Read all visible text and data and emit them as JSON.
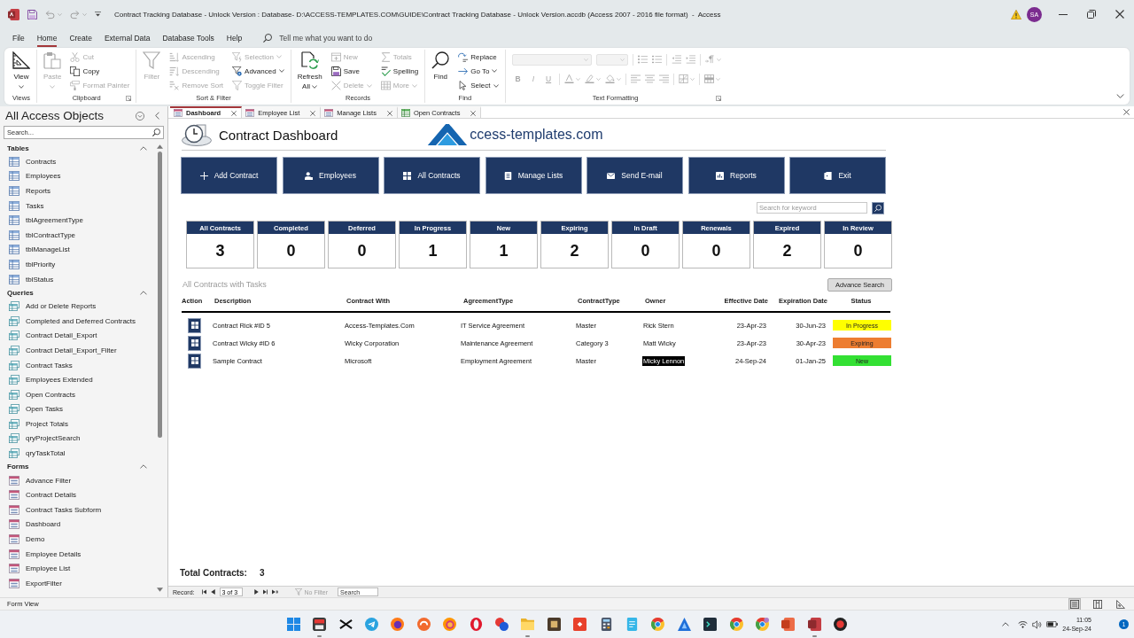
{
  "window": {
    "title": "Contract Tracking Database - Unlock Version : Database- D:\\ACCESS-TEMPLATES.COM\\GUIDE\\Contract Tracking Database - Unlock Version.accdb (Access 2007 - 2016 file format)  -  Access",
    "account_initials": "SA"
  },
  "menu_tabs": [
    {
      "label": "File",
      "selected": false
    },
    {
      "label": "Home",
      "selected": true
    },
    {
      "label": "Create",
      "selected": false
    },
    {
      "label": "External Data",
      "selected": false
    },
    {
      "label": "Database Tools",
      "selected": false
    },
    {
      "label": "Help",
      "selected": false
    }
  ],
  "tell_me": {
    "placeholder": "Tell me what you want to do"
  },
  "ribbon": {
    "groups": [
      {
        "label": "Views",
        "launcher": false,
        "columns": [
          {
            "kind": "large",
            "items": [
              {
                "label": "View",
                "disabled": false,
                "dropdown": true
              }
            ]
          }
        ]
      },
      {
        "label": "Clipboard",
        "launcher": true,
        "columns": [
          {
            "kind": "large",
            "items": [
              {
                "label": "Paste",
                "disabled": true,
                "dropdown": true
              }
            ]
          },
          {
            "kind": "small",
            "items": [
              {
                "label": "Cut",
                "disabled": true,
                "dropdown": false
              },
              {
                "label": "Copy",
                "disabled": false,
                "dropdown": false
              },
              {
                "label": "Format Painter",
                "disabled": true,
                "dropdown": false
              }
            ]
          }
        ]
      },
      {
        "label": "Sort & Filter",
        "launcher": false,
        "columns": [
          {
            "kind": "large",
            "items": [
              {
                "label": "Filter",
                "disabled": true,
                "dropdown": false
              }
            ]
          },
          {
            "kind": "small",
            "items": [
              {
                "label": "Ascending",
                "disabled": true,
                "dropdown": false
              },
              {
                "label": "Descending",
                "disabled": true,
                "dropdown": false
              },
              {
                "label": "Remove Sort",
                "disabled": true,
                "dropdown": false
              }
            ]
          },
          {
            "kind": "small",
            "items": [
              {
                "label": "Selection",
                "disabled": true,
                "dropdown": true
              },
              {
                "label": "Advanced",
                "disabled": false,
                "dropdown": true
              },
              {
                "label": "Toggle Filter",
                "disabled": true,
                "dropdown": false
              }
            ]
          }
        ]
      },
      {
        "label": "Records",
        "launcher": false,
        "columns": [
          {
            "kind": "large",
            "items": [
              {
                "label": "Refresh All",
                "disabled": false,
                "dropdown": true
              }
            ]
          },
          {
            "kind": "small",
            "items": [
              {
                "label": "New",
                "disabled": true,
                "dropdown": false
              },
              {
                "label": "Save",
                "disabled": false,
                "dropdown": false
              },
              {
                "label": "Delete",
                "disabled": true,
                "dropdown": true
              }
            ]
          },
          {
            "kind": "small",
            "items": [
              {
                "label": "Totals",
                "disabled": true,
                "dropdown": false
              },
              {
                "label": "Spelling",
                "disabled": false,
                "dropdown": false
              },
              {
                "label": "More",
                "disabled": true,
                "dropdown": true
              }
            ]
          }
        ]
      },
      {
        "label": "Find",
        "launcher": false,
        "columns": [
          {
            "kind": "large",
            "items": [
              {
                "label": "Find",
                "disabled": false,
                "dropdown": false
              }
            ]
          },
          {
            "kind": "small",
            "items": [
              {
                "label": "Replace",
                "disabled": false,
                "dropdown": false
              },
              {
                "label": "Go To",
                "disabled": false,
                "dropdown": true
              },
              {
                "label": "Select",
                "disabled": false,
                "dropdown": true
              }
            ]
          }
        ]
      }
    ],
    "text_formatting": {
      "label": "Text Formatting",
      "launcher": true,
      "disabled": true,
      "letters": [
        "B",
        "I",
        "U"
      ]
    }
  },
  "navigation": {
    "title": "All Access Objects",
    "search": {
      "placeholder": "Search..."
    },
    "groups": [
      {
        "label": "Tables",
        "kind": "table",
        "expanded": true,
        "items": [
          "Contracts",
          "Employees",
          "Reports",
          "Tasks",
          "tblAgreementType",
          "tblContractType",
          "tblManageList",
          "tblPriority",
          "tblStatus"
        ]
      },
      {
        "label": "Queries",
        "kind": "query",
        "expanded": true,
        "items": [
          "Add or Delete Reports",
          "Completed and Deferred Contracts",
          "Contract Detail_Export",
          "Contract Detail_Export_Filter",
          "Contract Tasks",
          "Employees Extended",
          "Open Contracts",
          "Open Tasks",
          "Project Totals",
          "qryProjectSearch",
          "qryTaskTotal"
        ]
      },
      {
        "label": "Forms",
        "kind": "form",
        "expanded": true,
        "items": [
          "Advance Filter",
          "Contract Details",
          "Contract Tasks Subform",
          "Dashboard",
          "Demo",
          "Employee Details",
          "Employee List",
          "ExportFilter"
        ]
      }
    ]
  },
  "document_tabs": [
    {
      "label": "Dashboard",
      "kind": "form",
      "selected": true
    },
    {
      "label": "Employee List",
      "kind": "form",
      "selected": false
    },
    {
      "label": "Manage Lists",
      "kind": "form",
      "selected": false
    },
    {
      "label": "Open Contracts",
      "kind": "datasheet",
      "selected": false
    }
  ],
  "form": {
    "title": "Contract Dashboard",
    "logo_text": "ccess-templates.com",
    "nav_buttons": [
      "Add Contract",
      "Employees",
      "All Contracts",
      "Manage Lists",
      "Send E-mail",
      "Reports",
      "Exit"
    ],
    "search": {
      "placeholder": "Search for keyword"
    },
    "stats": [
      {
        "label": "All Contracts",
        "value": "3"
      },
      {
        "label": "Completed",
        "value": "0"
      },
      {
        "label": "Deferred",
        "value": "0"
      },
      {
        "label": "In Progress",
        "value": "1"
      },
      {
        "label": "New",
        "value": "1"
      },
      {
        "label": "Expiring",
        "value": "2"
      },
      {
        "label": "In Draft",
        "value": "0"
      },
      {
        "label": "Renewals",
        "value": "0"
      },
      {
        "label": "Expired",
        "value": "2"
      },
      {
        "label": "In Review",
        "value": "0"
      }
    ],
    "section_title": "All Contracts with Tasks",
    "advance_search": "Advance Search",
    "table": {
      "columns": [
        "Action",
        "Description",
        "Contract With",
        "AgreementType",
        "ContractType",
        "Owner",
        "Effective Date",
        "Expiration Date",
        "Status"
      ],
      "rows": [
        {
          "description": "Contract Rick #ID 5",
          "contract_with": "Access-Templates.Com",
          "agreement_type": "IT Service Agreement",
          "contract_type": "Master",
          "owner": "Rick Stern",
          "effective_date": "23-Apr-23",
          "expiration_date": "30-Jun-23",
          "status": "In Progress",
          "color": "#ffff00",
          "selected": false
        },
        {
          "description": "Contract Wicky #ID 6",
          "contract_with": "Wicky Corporation",
          "agreement_type": "Maintenance Agreement",
          "contract_type": "Category 3",
          "owner": "Matt Wicky",
          "effective_date": "23-Apr-23",
          "expiration_date": "30-Apr-23",
          "status": "Expiring",
          "color": "#ed7d31",
          "selected": false
        },
        {
          "description": "Sample Contract",
          "contract_with": "Microsoft",
          "agreement_type": "Employment Agreement",
          "contract_type": "Master",
          "owner": "Micky Lennon",
          "effective_date": "24-Sep-24",
          "expiration_date": "01-Jan-25",
          "status": "New",
          "color": "#33e033",
          "selected": true
        }
      ]
    },
    "footer": {
      "label": "Total Contracts:",
      "value": "3"
    }
  },
  "record_nav": {
    "label": "Record:",
    "position": "3 of 3",
    "filter": {
      "label": "No Filter",
      "active": false
    },
    "search": {
      "placeholder": "Search"
    }
  },
  "status_bar": {
    "text": "Form View",
    "views": [
      {
        "selected": true
      },
      {
        "selected": false
      },
      {
        "selected": false
      }
    ]
  },
  "taskbar": {
    "apps": [
      {
        "running": false
      },
      {
        "running": true
      },
      {
        "running": false
      },
      {
        "running": false
      },
      {
        "running": false
      },
      {
        "running": false
      },
      {
        "running": false
      },
      {
        "running": false
      },
      {
        "running": false
      },
      {
        "running": true
      },
      {
        "running": false
      },
      {
        "running": false
      },
      {
        "running": false
      },
      {
        "running": false
      },
      {
        "running": false
      },
      {
        "running": false
      },
      {
        "running": false
      },
      {
        "running": false
      },
      {
        "running": false
      },
      {
        "running": false
      },
      {
        "running": true
      },
      {
        "running": false
      }
    ],
    "time": "11:05",
    "date": "24-Sep-24",
    "notification_count": "1"
  }
}
